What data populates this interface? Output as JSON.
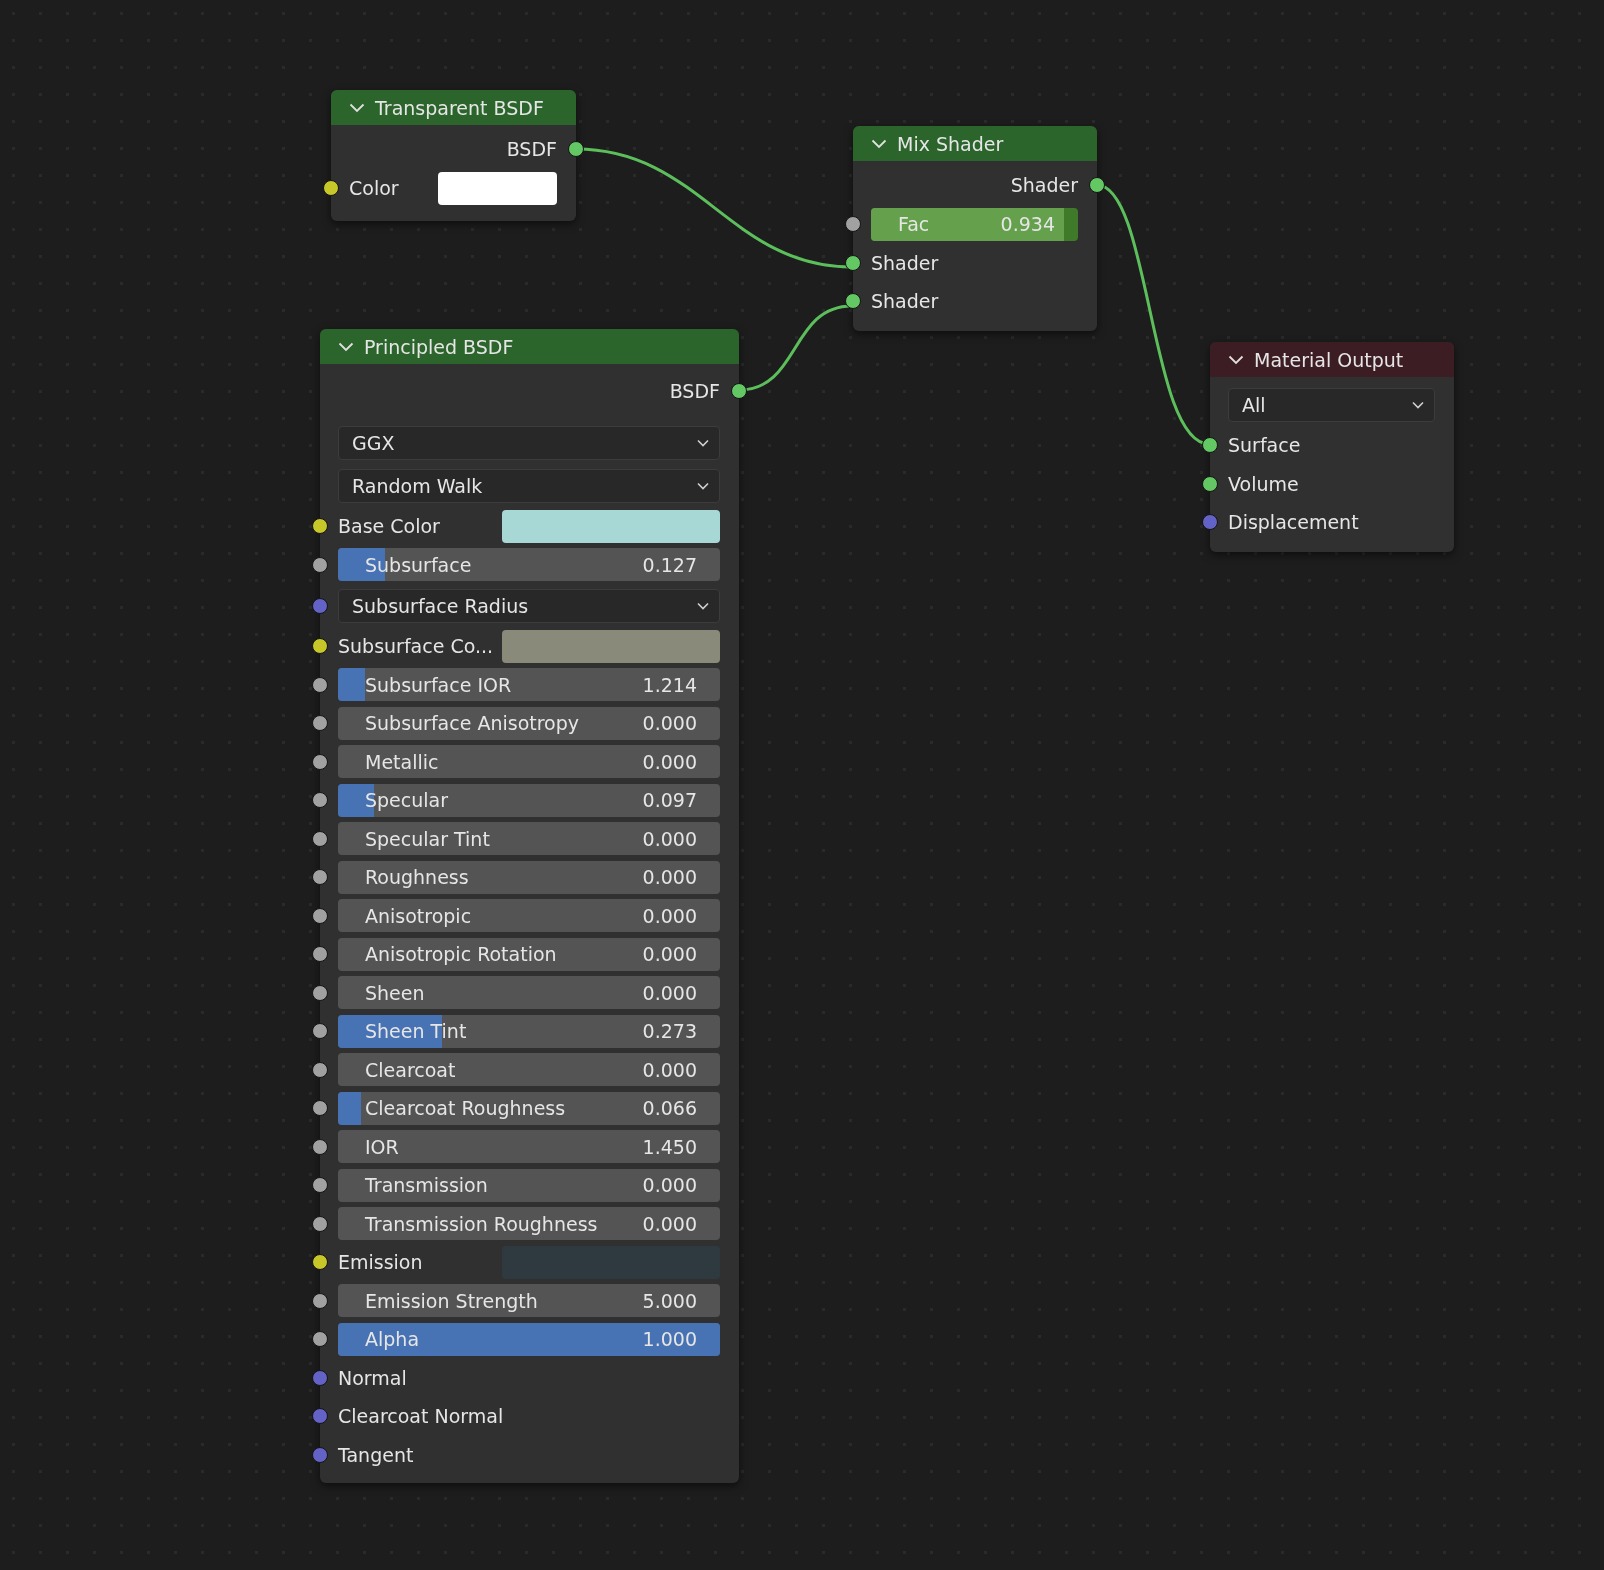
{
  "nodes": [
    {
      "title": "Transparent BSDF",
      "kind": "shader",
      "rows": [
        {
          "kind": "output",
          "label": "BSDF",
          "socket": {
            "color": "#63c763"
          }
        },
        {
          "kind": "color",
          "label": "Color",
          "socket": {
            "color": "#c7c729"
          },
          "color": "#ffffff"
        }
      ]
    },
    {
      "title": "Mix Shader",
      "kind": "shader",
      "rows": [
        {
          "kind": "output",
          "label": "Shader",
          "socket": {
            "color": "#63c763"
          }
        },
        {
          "kind": "factor",
          "label": "Fac",
          "value": "0.934",
          "level": 0.934,
          "socket": {
            "color": "#a1a1a1"
          }
        },
        {
          "kind": "input",
          "label": "Shader",
          "socket": {
            "color": "#63c763"
          }
        },
        {
          "kind": "input",
          "label": "Shader",
          "socket": {
            "color": "#63c763"
          }
        }
      ]
    },
    {
      "title": "Principled BSDF",
      "kind": "shader",
      "rows": [
        {
          "kind": "output",
          "label": "BSDF",
          "socket": {
            "color": "#63c763"
          }
        },
        {
          "kind": "dropdown",
          "label": "GGX"
        },
        {
          "kind": "dropdown",
          "label": "Random Walk"
        },
        {
          "kind": "color",
          "label": "Base Color",
          "socket": {
            "color": "#c7c729"
          },
          "color": "#a8d8d6"
        },
        {
          "kind": "slider",
          "label": "Subsurface",
          "value": "0.127",
          "level": 0.123,
          "socket": {
            "color": "#a1a1a1"
          }
        },
        {
          "kind": "dropdown",
          "label": "Subsurface Radius",
          "socket": {
            "color": "#6363c7"
          }
        },
        {
          "kind": "color",
          "label": "Subsurface Co...",
          "socket": {
            "color": "#c7c729"
          },
          "color": "#8a8a7a"
        },
        {
          "kind": "slider",
          "label": "Subsurface IOR",
          "value": "1.214",
          "level": 0.07,
          "socket": {
            "color": "#a1a1a1"
          }
        },
        {
          "kind": "slider",
          "label": "Subsurface Anisotropy",
          "value": "0.000",
          "level": 0,
          "socket": {
            "color": "#a1a1a1"
          }
        },
        {
          "kind": "slider",
          "label": "Metallic",
          "value": "0.000",
          "level": 0,
          "socket": {
            "color": "#a1a1a1"
          }
        },
        {
          "kind": "slider",
          "label": "Specular",
          "value": "0.097",
          "level": 0.094,
          "socket": {
            "color": "#a1a1a1"
          }
        },
        {
          "kind": "slider",
          "label": "Specular Tint",
          "value": "0.000",
          "level": 0,
          "socket": {
            "color": "#a1a1a1"
          }
        },
        {
          "kind": "slider",
          "label": "Roughness",
          "value": "0.000",
          "level": 0,
          "socket": {
            "color": "#a1a1a1"
          }
        },
        {
          "kind": "slider",
          "label": "Anisotropic",
          "value": "0.000",
          "level": 0,
          "socket": {
            "color": "#a1a1a1"
          }
        },
        {
          "kind": "slider",
          "label": "Anisotropic Rotation",
          "value": "0.000",
          "level": 0,
          "socket": {
            "color": "#a1a1a1"
          }
        },
        {
          "kind": "slider",
          "label": "Sheen",
          "value": "0.000",
          "level": 0,
          "socket": {
            "color": "#a1a1a1"
          }
        },
        {
          "kind": "slider",
          "label": "Sheen Tint",
          "value": "0.273",
          "level": 0.273,
          "socket": {
            "color": "#a1a1a1"
          }
        },
        {
          "kind": "slider",
          "label": "Clearcoat",
          "value": "0.000",
          "level": 0,
          "socket": {
            "color": "#a1a1a1"
          }
        },
        {
          "kind": "slider",
          "label": "Clearcoat Roughness",
          "value": "0.066",
          "level": 0.061,
          "socket": {
            "color": "#a1a1a1"
          }
        },
        {
          "kind": "slider",
          "label": "IOR",
          "value": "1.450",
          "level": 0,
          "socket": {
            "color": "#a1a1a1"
          }
        },
        {
          "kind": "slider",
          "label": "Transmission",
          "value": "0.000",
          "level": 0,
          "socket": {
            "color": "#a1a1a1"
          }
        },
        {
          "kind": "slider",
          "label": "Transmission Roughness",
          "value": "0.000",
          "level": 0,
          "socket": {
            "color": "#a1a1a1"
          }
        },
        {
          "kind": "color",
          "label": "Emission",
          "socket": {
            "color": "#c7c729"
          },
          "color": "#2f3a40"
        },
        {
          "kind": "slider",
          "label": "Emission Strength",
          "value": "5.000",
          "level": 0,
          "socket": {
            "color": "#a1a1a1"
          }
        },
        {
          "kind": "slider",
          "label": "Alpha",
          "value": "1.000",
          "level": 1,
          "socket": {
            "color": "#a1a1a1"
          }
        },
        {
          "kind": "input",
          "label": "Normal",
          "socket": {
            "color": "#6363c7"
          }
        },
        {
          "kind": "input",
          "label": "Clearcoat Normal",
          "socket": {
            "color": "#6363c7"
          }
        },
        {
          "kind": "input",
          "label": "Tangent",
          "socket": {
            "color": "#6363c7"
          }
        }
      ]
    },
    {
      "title": "Material Output",
      "kind": "output",
      "rows": [
        {
          "kind": "dropdown",
          "label": "All"
        },
        {
          "kind": "input",
          "label": "Surface",
          "socket": {
            "color": "#63c763"
          }
        },
        {
          "kind": "input",
          "label": "Volume",
          "socket": {
            "color": "#63c763"
          }
        },
        {
          "kind": "input",
          "label": "Displacement",
          "socket": {
            "color": "#6363c7"
          }
        }
      ]
    }
  ]
}
